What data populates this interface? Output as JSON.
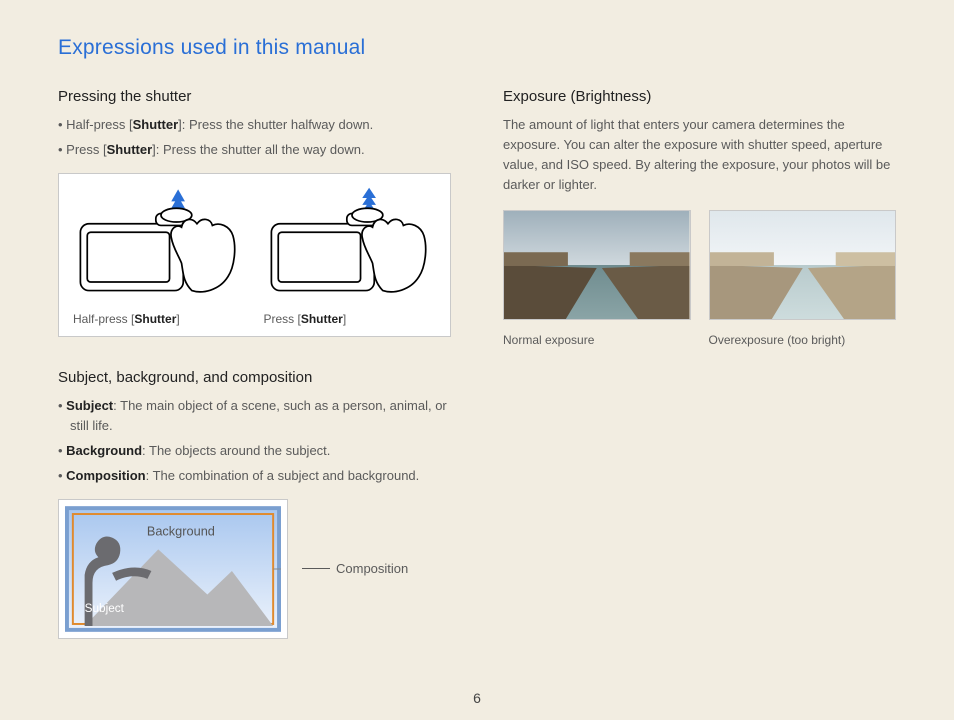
{
  "title": "Expressions used in this manual",
  "page_number": "6",
  "left": {
    "shutter": {
      "heading": "Pressing the shutter",
      "bullets": [
        {
          "pre": "Half-press [",
          "bold": "Shutter",
          "post": "]: Press the shutter halfway down."
        },
        {
          "pre": "Press [",
          "bold": "Shutter",
          "post": "]: Press the shutter all the way down."
        }
      ],
      "fig": {
        "caption_half_pre": "Half-press [",
        "caption_half_bold": "Shutter",
        "caption_half_post": "]",
        "caption_full_pre": "Press [",
        "caption_full_bold": "Shutter",
        "caption_full_post": "]"
      }
    },
    "sbc": {
      "heading": "Subject, background, and composition",
      "bullets": [
        {
          "bold": "Subject",
          "post": ": The main object of a scene, such as a person, animal, or still life."
        },
        {
          "bold": "Background",
          "post": ": The objects around the subject."
        },
        {
          "bold": "Composition",
          "post": ": The combination of a subject and background."
        }
      ],
      "labels": {
        "background": "Background",
        "subject": "Subject",
        "composition": "Composition"
      }
    }
  },
  "right": {
    "exposure": {
      "heading": "Exposure (Brightness)",
      "body": "The amount of light that enters your camera determines the exposure. You can alter the exposure with shutter speed, aperture value, and ISO speed. By altering the exposure, your photos will be darker or lighter.",
      "caption_normal": "Normal exposure",
      "caption_over": "Overexposure (too bright)"
    }
  }
}
